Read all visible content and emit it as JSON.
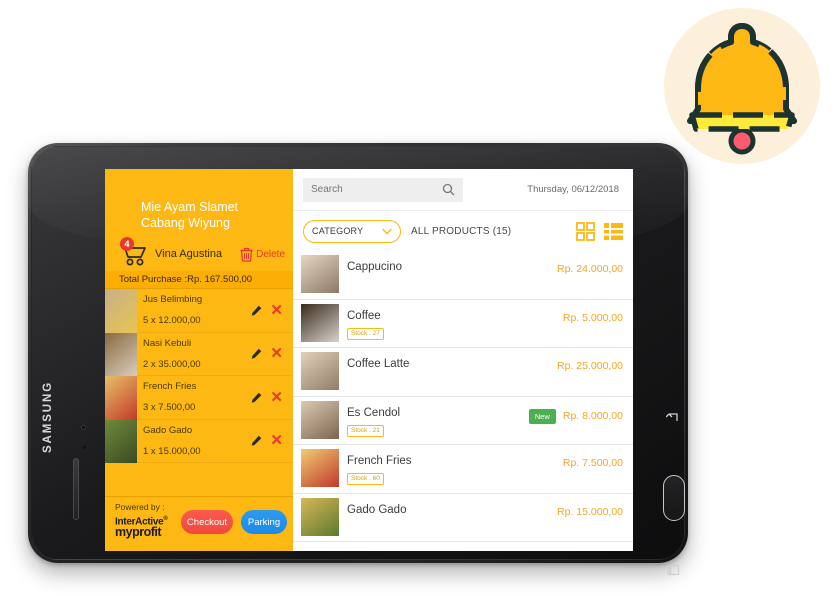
{
  "decoration": {
    "bell_icon_name": "notification-bell-icon",
    "bell_body_color": "#fdb813",
    "bell_band_color": "#ffe93b",
    "bell_clapper_color": "#ff5b6e",
    "bell_outline_color": "#1d3330",
    "bell_circle_color": "#fdf0db"
  },
  "device": {
    "brand": "SAMSUNG",
    "nav": {
      "back": "back-icon",
      "home": "home-button",
      "recents": "recents-icon"
    }
  },
  "cart_panel": {
    "store_name": "Mie Ayam Slamet Cabang Wiyung",
    "cart_badge_count": "4",
    "cashier_name": "Vina Agustina",
    "delete_label": "Delete",
    "total_purchase": "Total Purchase :Rp. 167.500,00",
    "powered_by_label": "Powered by :",
    "brand_line1": "InterActive",
    "brand_reg": "®",
    "brand_line2": "myprofit",
    "checkout_label": "Checkout",
    "parking_label": "Parking",
    "panel_color": "#fdb813",
    "items": [
      {
        "name": "Jus Belimbing",
        "qty_line": "5 x 12.000,00",
        "thumb_a": "#c7b08a",
        "thumb_b": "#e8c44f"
      },
      {
        "name": "Nasi Kebuli",
        "qty_line": "2 x 35.000,00",
        "thumb_a": "#8a6a42",
        "thumb_b": "#d8cdbb"
      },
      {
        "name": "French Fries",
        "qty_line": "3 x 7.500,00",
        "thumb_a": "#e8c067",
        "thumb_b": "#c23a2a"
      },
      {
        "name": "Gado Gado",
        "qty_line": "1 x 15.000,00",
        "thumb_a": "#6f8a3a",
        "thumb_b": "#3a4a22"
      }
    ]
  },
  "products_panel": {
    "search_placeholder": "Search",
    "search_value": "",
    "date_label": "Thursday, 06/12/2018",
    "category_label": "CATEGORY",
    "all_products_label": "ALL PRODUCTS (15)",
    "accent_color": "#fdb813",
    "price_color": "#f5a623",
    "view_modes": [
      "grid-view",
      "list-view"
    ],
    "active_view": "list-view",
    "items": [
      {
        "name": "Cappucino",
        "price": "Rp. 24.000,00",
        "stock": "",
        "badge": "",
        "thumb_a": "#e6d6c2",
        "thumb_b": "#8c7a66"
      },
      {
        "name": "Coffee",
        "price": "Rp. 5.000,00",
        "stock": "Stock : 27",
        "badge": "",
        "thumb_a": "#3a2a1c",
        "thumb_b": "#d8d2cc"
      },
      {
        "name": "Coffee Latte",
        "price": "Rp. 25.000,00",
        "stock": "",
        "badge": "",
        "thumb_a": "#e2d0ba",
        "thumb_b": "#907d67"
      },
      {
        "name": "Es Cendol",
        "price": "Rp. 8.000,00",
        "stock": "Stock : 21",
        "badge": "New",
        "thumb_a": "#ddc9b2",
        "thumb_b": "#7b6550"
      },
      {
        "name": "French Fries",
        "price": "Rp. 7.500,00",
        "stock": "Stock : 60",
        "badge": "",
        "thumb_a": "#f0cd72",
        "thumb_b": "#c0392b"
      },
      {
        "name": "Gado Gado",
        "price": "Rp. 15.000,00",
        "stock": "",
        "badge": "",
        "thumb_a": "#d8b658",
        "thumb_b": "#5c7a2e"
      }
    ]
  }
}
